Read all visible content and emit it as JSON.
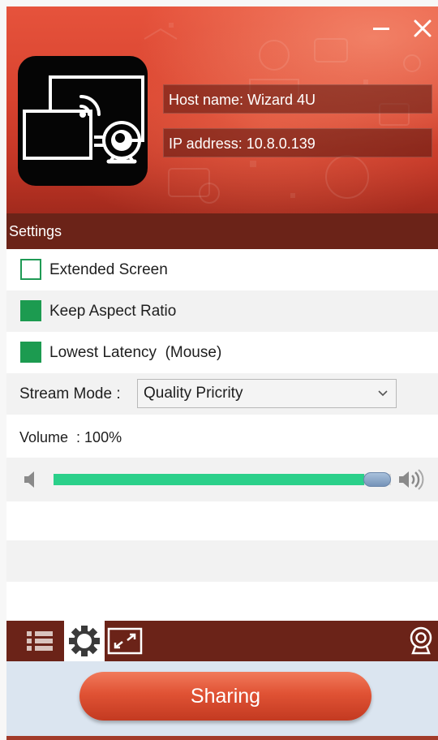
{
  "window": {
    "minimize_icon": "minimize-icon",
    "close_icon": "close-icon"
  },
  "header": {
    "app_icon": "screen-cast-webcam-icon",
    "host_name": "Host name: Wizard 4U",
    "ip_address": "IP address: 10.8.0.139"
  },
  "settings": {
    "title": "Settings",
    "options": [
      {
        "label": "Extended Screen",
        "checked": false
      },
      {
        "label": "Keep Aspect Ratio",
        "checked": true
      },
      {
        "label": "Lowest Latency  (Mouse)",
        "checked": true
      }
    ],
    "stream_mode": {
      "label": "Stream Mode :",
      "selected": "Quality Pricrity"
    },
    "volume": {
      "label": "Volume  : 100%",
      "value": 100
    }
  },
  "toolbar": {
    "items": [
      "list-icon",
      "gear-icon",
      "fit-screen-icon",
      "webcam-icon"
    ],
    "active": "gear-icon"
  },
  "share": {
    "label": "Sharing"
  },
  "colors": {
    "header_red": "#d8432f",
    "dark_maroon": "#6b2318",
    "check_green": "#1c9b50",
    "slider_green": "#2bd08a",
    "share_area": "#dbe5f0"
  }
}
